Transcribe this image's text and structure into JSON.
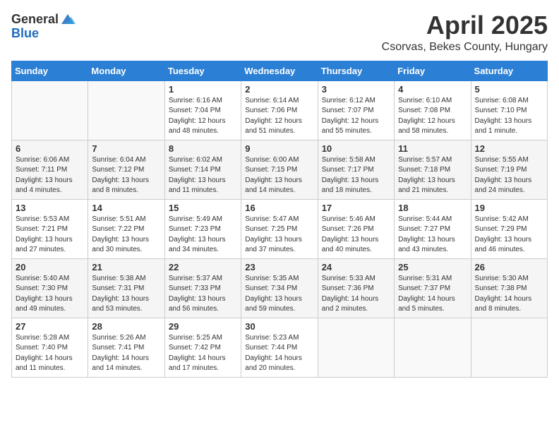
{
  "header": {
    "logo_general": "General",
    "logo_blue": "Blue",
    "month": "April 2025",
    "location": "Csorvas, Bekes County, Hungary"
  },
  "days_of_week": [
    "Sunday",
    "Monday",
    "Tuesday",
    "Wednesday",
    "Thursday",
    "Friday",
    "Saturday"
  ],
  "weeks": [
    [
      {
        "day": "",
        "info": ""
      },
      {
        "day": "",
        "info": ""
      },
      {
        "day": "1",
        "info": "Sunrise: 6:16 AM\nSunset: 7:04 PM\nDaylight: 12 hours\nand 48 minutes."
      },
      {
        "day": "2",
        "info": "Sunrise: 6:14 AM\nSunset: 7:06 PM\nDaylight: 12 hours\nand 51 minutes."
      },
      {
        "day": "3",
        "info": "Sunrise: 6:12 AM\nSunset: 7:07 PM\nDaylight: 12 hours\nand 55 minutes."
      },
      {
        "day": "4",
        "info": "Sunrise: 6:10 AM\nSunset: 7:08 PM\nDaylight: 12 hours\nand 58 minutes."
      },
      {
        "day": "5",
        "info": "Sunrise: 6:08 AM\nSunset: 7:10 PM\nDaylight: 13 hours\nand 1 minute."
      }
    ],
    [
      {
        "day": "6",
        "info": "Sunrise: 6:06 AM\nSunset: 7:11 PM\nDaylight: 13 hours\nand 4 minutes."
      },
      {
        "day": "7",
        "info": "Sunrise: 6:04 AM\nSunset: 7:12 PM\nDaylight: 13 hours\nand 8 minutes."
      },
      {
        "day": "8",
        "info": "Sunrise: 6:02 AM\nSunset: 7:14 PM\nDaylight: 13 hours\nand 11 minutes."
      },
      {
        "day": "9",
        "info": "Sunrise: 6:00 AM\nSunset: 7:15 PM\nDaylight: 13 hours\nand 14 minutes."
      },
      {
        "day": "10",
        "info": "Sunrise: 5:58 AM\nSunset: 7:17 PM\nDaylight: 13 hours\nand 18 minutes."
      },
      {
        "day": "11",
        "info": "Sunrise: 5:57 AM\nSunset: 7:18 PM\nDaylight: 13 hours\nand 21 minutes."
      },
      {
        "day": "12",
        "info": "Sunrise: 5:55 AM\nSunset: 7:19 PM\nDaylight: 13 hours\nand 24 minutes."
      }
    ],
    [
      {
        "day": "13",
        "info": "Sunrise: 5:53 AM\nSunset: 7:21 PM\nDaylight: 13 hours\nand 27 minutes."
      },
      {
        "day": "14",
        "info": "Sunrise: 5:51 AM\nSunset: 7:22 PM\nDaylight: 13 hours\nand 30 minutes."
      },
      {
        "day": "15",
        "info": "Sunrise: 5:49 AM\nSunset: 7:23 PM\nDaylight: 13 hours\nand 34 minutes."
      },
      {
        "day": "16",
        "info": "Sunrise: 5:47 AM\nSunset: 7:25 PM\nDaylight: 13 hours\nand 37 minutes."
      },
      {
        "day": "17",
        "info": "Sunrise: 5:46 AM\nSunset: 7:26 PM\nDaylight: 13 hours\nand 40 minutes."
      },
      {
        "day": "18",
        "info": "Sunrise: 5:44 AM\nSunset: 7:27 PM\nDaylight: 13 hours\nand 43 minutes."
      },
      {
        "day": "19",
        "info": "Sunrise: 5:42 AM\nSunset: 7:29 PM\nDaylight: 13 hours\nand 46 minutes."
      }
    ],
    [
      {
        "day": "20",
        "info": "Sunrise: 5:40 AM\nSunset: 7:30 PM\nDaylight: 13 hours\nand 49 minutes."
      },
      {
        "day": "21",
        "info": "Sunrise: 5:38 AM\nSunset: 7:31 PM\nDaylight: 13 hours\nand 53 minutes."
      },
      {
        "day": "22",
        "info": "Sunrise: 5:37 AM\nSunset: 7:33 PM\nDaylight: 13 hours\nand 56 minutes."
      },
      {
        "day": "23",
        "info": "Sunrise: 5:35 AM\nSunset: 7:34 PM\nDaylight: 13 hours\nand 59 minutes."
      },
      {
        "day": "24",
        "info": "Sunrise: 5:33 AM\nSunset: 7:36 PM\nDaylight: 14 hours\nand 2 minutes."
      },
      {
        "day": "25",
        "info": "Sunrise: 5:31 AM\nSunset: 7:37 PM\nDaylight: 14 hours\nand 5 minutes."
      },
      {
        "day": "26",
        "info": "Sunrise: 5:30 AM\nSunset: 7:38 PM\nDaylight: 14 hours\nand 8 minutes."
      }
    ],
    [
      {
        "day": "27",
        "info": "Sunrise: 5:28 AM\nSunset: 7:40 PM\nDaylight: 14 hours\nand 11 minutes."
      },
      {
        "day": "28",
        "info": "Sunrise: 5:26 AM\nSunset: 7:41 PM\nDaylight: 14 hours\nand 14 minutes."
      },
      {
        "day": "29",
        "info": "Sunrise: 5:25 AM\nSunset: 7:42 PM\nDaylight: 14 hours\nand 17 minutes."
      },
      {
        "day": "30",
        "info": "Sunrise: 5:23 AM\nSunset: 7:44 PM\nDaylight: 14 hours\nand 20 minutes."
      },
      {
        "day": "",
        "info": ""
      },
      {
        "day": "",
        "info": ""
      },
      {
        "day": "",
        "info": ""
      }
    ]
  ]
}
